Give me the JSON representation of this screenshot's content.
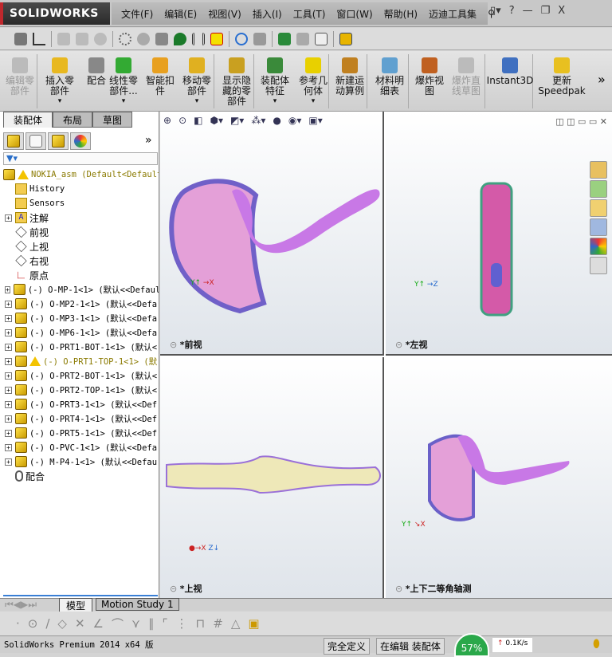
{
  "app": {
    "logo": "SOLIDWORKS"
  },
  "menu": [
    "文件(F)",
    "编辑(E)",
    "视图(V)",
    "插入(I)",
    "工具(T)",
    "窗口(W)",
    "帮助(H)",
    "迈迪工具集"
  ],
  "window_controls": {
    "help": "?",
    "minimize": "—",
    "restore": "❐",
    "close": "X"
  },
  "command_manager": [
    {
      "label": "编辑零\n部件",
      "disabled": true
    },
    {
      "label": "插入零\n部件",
      "dropdown": true
    },
    {
      "label": "配合"
    },
    {
      "label": "线性零\n部件...",
      "dropdown": true
    },
    {
      "label": "智能扣\n件"
    },
    {
      "label": "移动零\n部件",
      "dropdown": true
    },
    {
      "label": "显示隐\n藏的零\n部件"
    },
    {
      "label": "装配体\n特征",
      "dropdown": true
    },
    {
      "label": "参考几\n何体",
      "dropdown": true
    },
    {
      "label": "新建运\n动算例"
    },
    {
      "label": "材料明\n细表"
    },
    {
      "label": "爆炸视\n图"
    },
    {
      "label": "爆炸直\n线草图",
      "disabled": true
    },
    {
      "label": "Instant3D"
    },
    {
      "label": "更新\nSpeedpak"
    }
  ],
  "more": "»",
  "left_panel": {
    "tabs": [
      "装配体",
      "布局",
      "草图"
    ],
    "expand": "»",
    "tree": {
      "root": "NOKIA_asm  (Default<Default",
      "items": [
        {
          "label": "History",
          "kind": "folder"
        },
        {
          "label": "Sensors",
          "kind": "folder"
        },
        {
          "label": "注解",
          "kind": "annot",
          "expand": true
        },
        {
          "label": "前视",
          "kind": "plane"
        },
        {
          "label": "上视",
          "kind": "plane"
        },
        {
          "label": "右视",
          "kind": "plane"
        },
        {
          "label": "原点",
          "kind": "origin"
        },
        {
          "label": "(-) O-MP-1<1> (默认<<Default",
          "kind": "part"
        },
        {
          "label": "(-) O-MP2-1<1> (默认<<Defa",
          "kind": "part"
        },
        {
          "label": "(-) O-MP3-1<1> (默认<<Defa",
          "kind": "part"
        },
        {
          "label": "(-) O-MP6-1<1> (默认<<Defa",
          "kind": "part"
        },
        {
          "label": "(-) O-PRT1-BOT-1<1> (默认<",
          "kind": "part"
        },
        {
          "label": "(-) O-PRT1-TOP-1<1> (默",
          "kind": "part",
          "warning": true
        },
        {
          "label": "(-) O-PRT2-BOT-1<1> (默认<",
          "kind": "part"
        },
        {
          "label": "(-) O-PRT2-TOP-1<1> (默认<",
          "kind": "part"
        },
        {
          "label": "(-) O-PRT3-1<1> (默认<<Def",
          "kind": "part"
        },
        {
          "label": "(-) O-PRT4-1<1> (默认<<Def",
          "kind": "part"
        },
        {
          "label": "(-) O-PRT5-1<1> (默认<<Def",
          "kind": "part"
        },
        {
          "label": "(-) O-PVC-1<1> (默认<<Defa",
          "kind": "part"
        },
        {
          "label": "(-) M-P4-1<1> (默认<<Defau",
          "kind": "part"
        },
        {
          "label": "配合",
          "kind": "mates"
        }
      ]
    }
  },
  "viewports": [
    {
      "label": "*前视"
    },
    {
      "label": "*左视"
    },
    {
      "label": "*上视"
    },
    {
      "label": "*上下二等角轴测"
    }
  ],
  "bottom_tabs": [
    "模型",
    "Motion Study 1"
  ],
  "status": {
    "product": "SolidWorks Premium 2014 x64 版",
    "state": "完全定义",
    "mode": "在编辑 装配体",
    "percent": "57%",
    "speed": "0.1K/s"
  }
}
